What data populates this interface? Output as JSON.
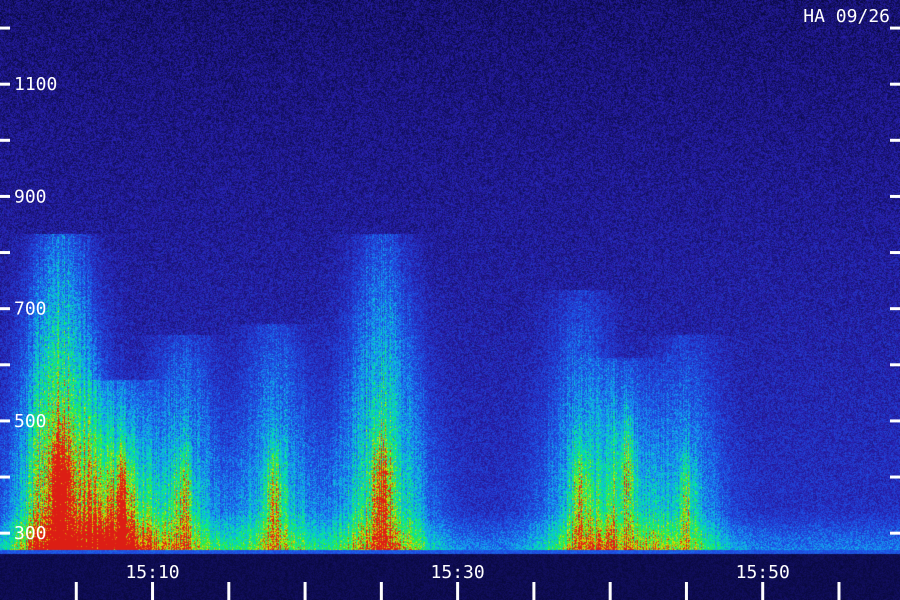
{
  "station_label": "HA 09/26",
  "chart_data": {
    "type": "heatmap",
    "title": "",
    "xlabel": "",
    "ylabel": "",
    "x_range": [
      "15:00",
      "15:59"
    ],
    "y_range": [
      270,
      1250
    ],
    "y_ticks": [
      {
        "value": 300,
        "label": "300"
      },
      {
        "value": 400,
        "label": ""
      },
      {
        "value": 500,
        "label": "500"
      },
      {
        "value": 600,
        "label": ""
      },
      {
        "value": 700,
        "label": "700"
      },
      {
        "value": 800,
        "label": ""
      },
      {
        "value": 900,
        "label": "900"
      },
      {
        "value": 1000,
        "label": ""
      },
      {
        "value": 1100,
        "label": "1100"
      },
      {
        "value": 1200,
        "label": ""
      }
    ],
    "x_ticks": [
      {
        "value": "15:05",
        "label": ""
      },
      {
        "value": "15:10",
        "label": "15:10"
      },
      {
        "value": "15:15",
        "label": ""
      },
      {
        "value": "15:20",
        "label": ""
      },
      {
        "value": "15:25",
        "label": ""
      },
      {
        "value": "15:30",
        "label": "15:30"
      },
      {
        "value": "15:35",
        "label": ""
      },
      {
        "value": "15:40",
        "label": ""
      },
      {
        "value": "15:45",
        "label": ""
      },
      {
        "value": "15:50",
        "label": "15:50"
      },
      {
        "value": "15:55",
        "label": ""
      }
    ],
    "intensity_events": [
      {
        "time": "15:04",
        "upper_freq": 780,
        "peak_freq": 390,
        "peak_intensity": 1.0
      },
      {
        "time": "15:08",
        "upper_freq": 520,
        "peak_freq": 350,
        "peak_intensity": 0.65
      },
      {
        "time": "15:12",
        "upper_freq": 600,
        "peak_freq": 360,
        "peak_intensity": 0.5
      },
      {
        "time": "15:18",
        "upper_freq": 620,
        "peak_freq": 360,
        "peak_intensity": 0.5
      },
      {
        "time": "15:25",
        "upper_freq": 780,
        "peak_freq": 370,
        "peak_intensity": 0.7
      },
      {
        "time": "15:38",
        "upper_freq": 680,
        "peak_freq": 370,
        "peak_intensity": 0.45
      },
      {
        "time": "15:41",
        "upper_freq": 560,
        "peak_freq": 420,
        "peak_intensity": 0.45
      },
      {
        "time": "15:45",
        "upper_freq": 600,
        "peak_freq": 360,
        "peak_intensity": 0.4
      }
    ],
    "colors": {
      "background": "#000000",
      "noise": "#1c1c8c",
      "axis": "#ffffff"
    },
    "grid": false,
    "legend": "none"
  }
}
